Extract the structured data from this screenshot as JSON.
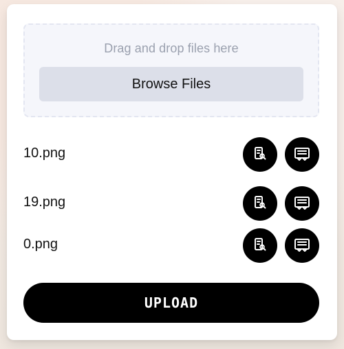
{
  "dropzone": {
    "hint": "Drag and drop files here",
    "browse_label": "Browse Files"
  },
  "files": [
    {
      "name": "10.png",
      "preview_icon": "document-search-icon",
      "caption_icon": "message-caption-icon"
    },
    {
      "name": "19.png",
      "preview_icon": "document-search-icon",
      "caption_icon": "message-caption-icon"
    },
    {
      "name": "0.png",
      "preview_icon": "document-search-icon",
      "caption_icon": "message-caption-icon"
    }
  ],
  "upload": {
    "label": "UPLOAD"
  },
  "colors": {
    "page_background": "#f3ece6",
    "card": "#ffffff",
    "dropzone_background": "#f5f6fb",
    "dropzone_border": "#e3e6f1",
    "browse_button": "#dcdfe9",
    "accent_dark": "#000000",
    "hint_text": "#9aa0ae",
    "text": "#111111"
  }
}
